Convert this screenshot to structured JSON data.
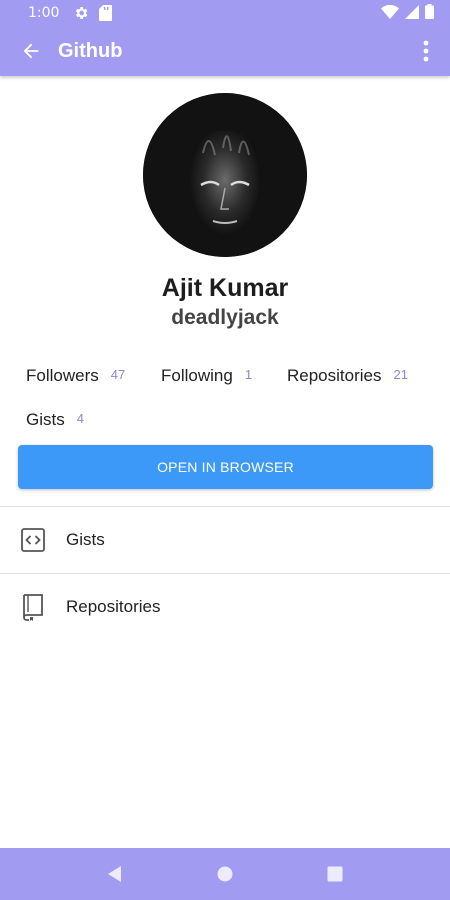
{
  "status_bar": {
    "time": "1:00",
    "icons": [
      "settings-icon",
      "sd-card-icon",
      "wifi-icon",
      "signal-icon",
      "battery-icon"
    ]
  },
  "app_bar": {
    "title": "Github",
    "back_icon": "arrow-back-icon",
    "menu_icon": "more-vert-icon"
  },
  "profile": {
    "name": "Ajit Kumar",
    "username": "deadlyjack"
  },
  "stats": {
    "followers": {
      "label": "Followers",
      "count": "47"
    },
    "following": {
      "label": "Following",
      "count": "1"
    },
    "repositories": {
      "label": "Repositories",
      "count": "21"
    },
    "gists": {
      "label": "Gists",
      "count": "4"
    }
  },
  "actions": {
    "open_in_browser": "OPEN IN BROWSER"
  },
  "list": [
    {
      "label": "Gists",
      "icon": "code-icon"
    },
    {
      "label": "Repositories",
      "icon": "book-icon"
    }
  ],
  "colors": {
    "app_bar": "#a19bf2",
    "button": "#3d99f7",
    "count_accent": "#8c86d6"
  }
}
